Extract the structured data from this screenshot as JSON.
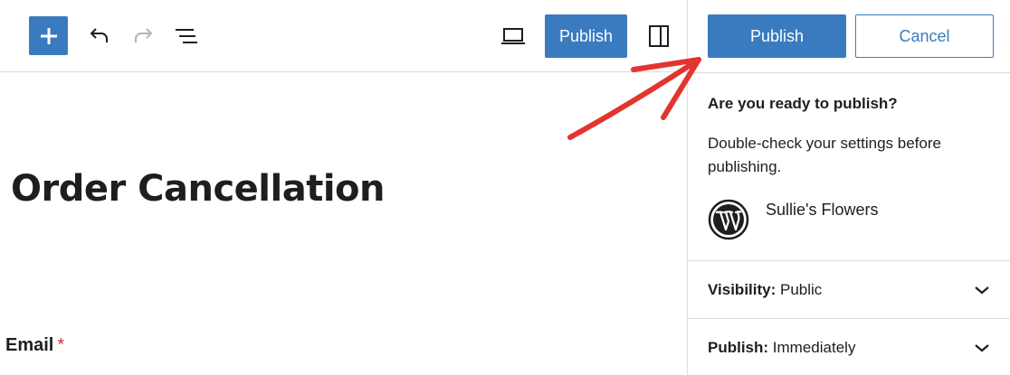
{
  "toolbar": {
    "publish_label": "Publish"
  },
  "editor": {
    "title": "Order Cancellation",
    "field_label": "Email",
    "required_mark": "*"
  },
  "panel": {
    "publish_label": "Publish",
    "cancel_label": "Cancel",
    "question": "Are you ready to publish?",
    "description": "Double-check your settings before publishing.",
    "site_name": "Sullie's Flowers",
    "visibility_label": "Visibility:",
    "visibility_value": "Public",
    "publish_row_label": "Publish:",
    "publish_row_value": "Immediately"
  },
  "colors": {
    "accent": "#3a7bbf",
    "annotation_arrow": "#e3342f",
    "required": "#d63638"
  },
  "icons": {
    "add": "plus-icon",
    "undo": "undo-icon",
    "redo": "redo-icon",
    "outline": "list-view-icon",
    "preview": "laptop-icon",
    "sidebar": "sidebar-toggle-icon",
    "site": "wordpress-logo-icon",
    "expand": "chevron-down-icon"
  }
}
